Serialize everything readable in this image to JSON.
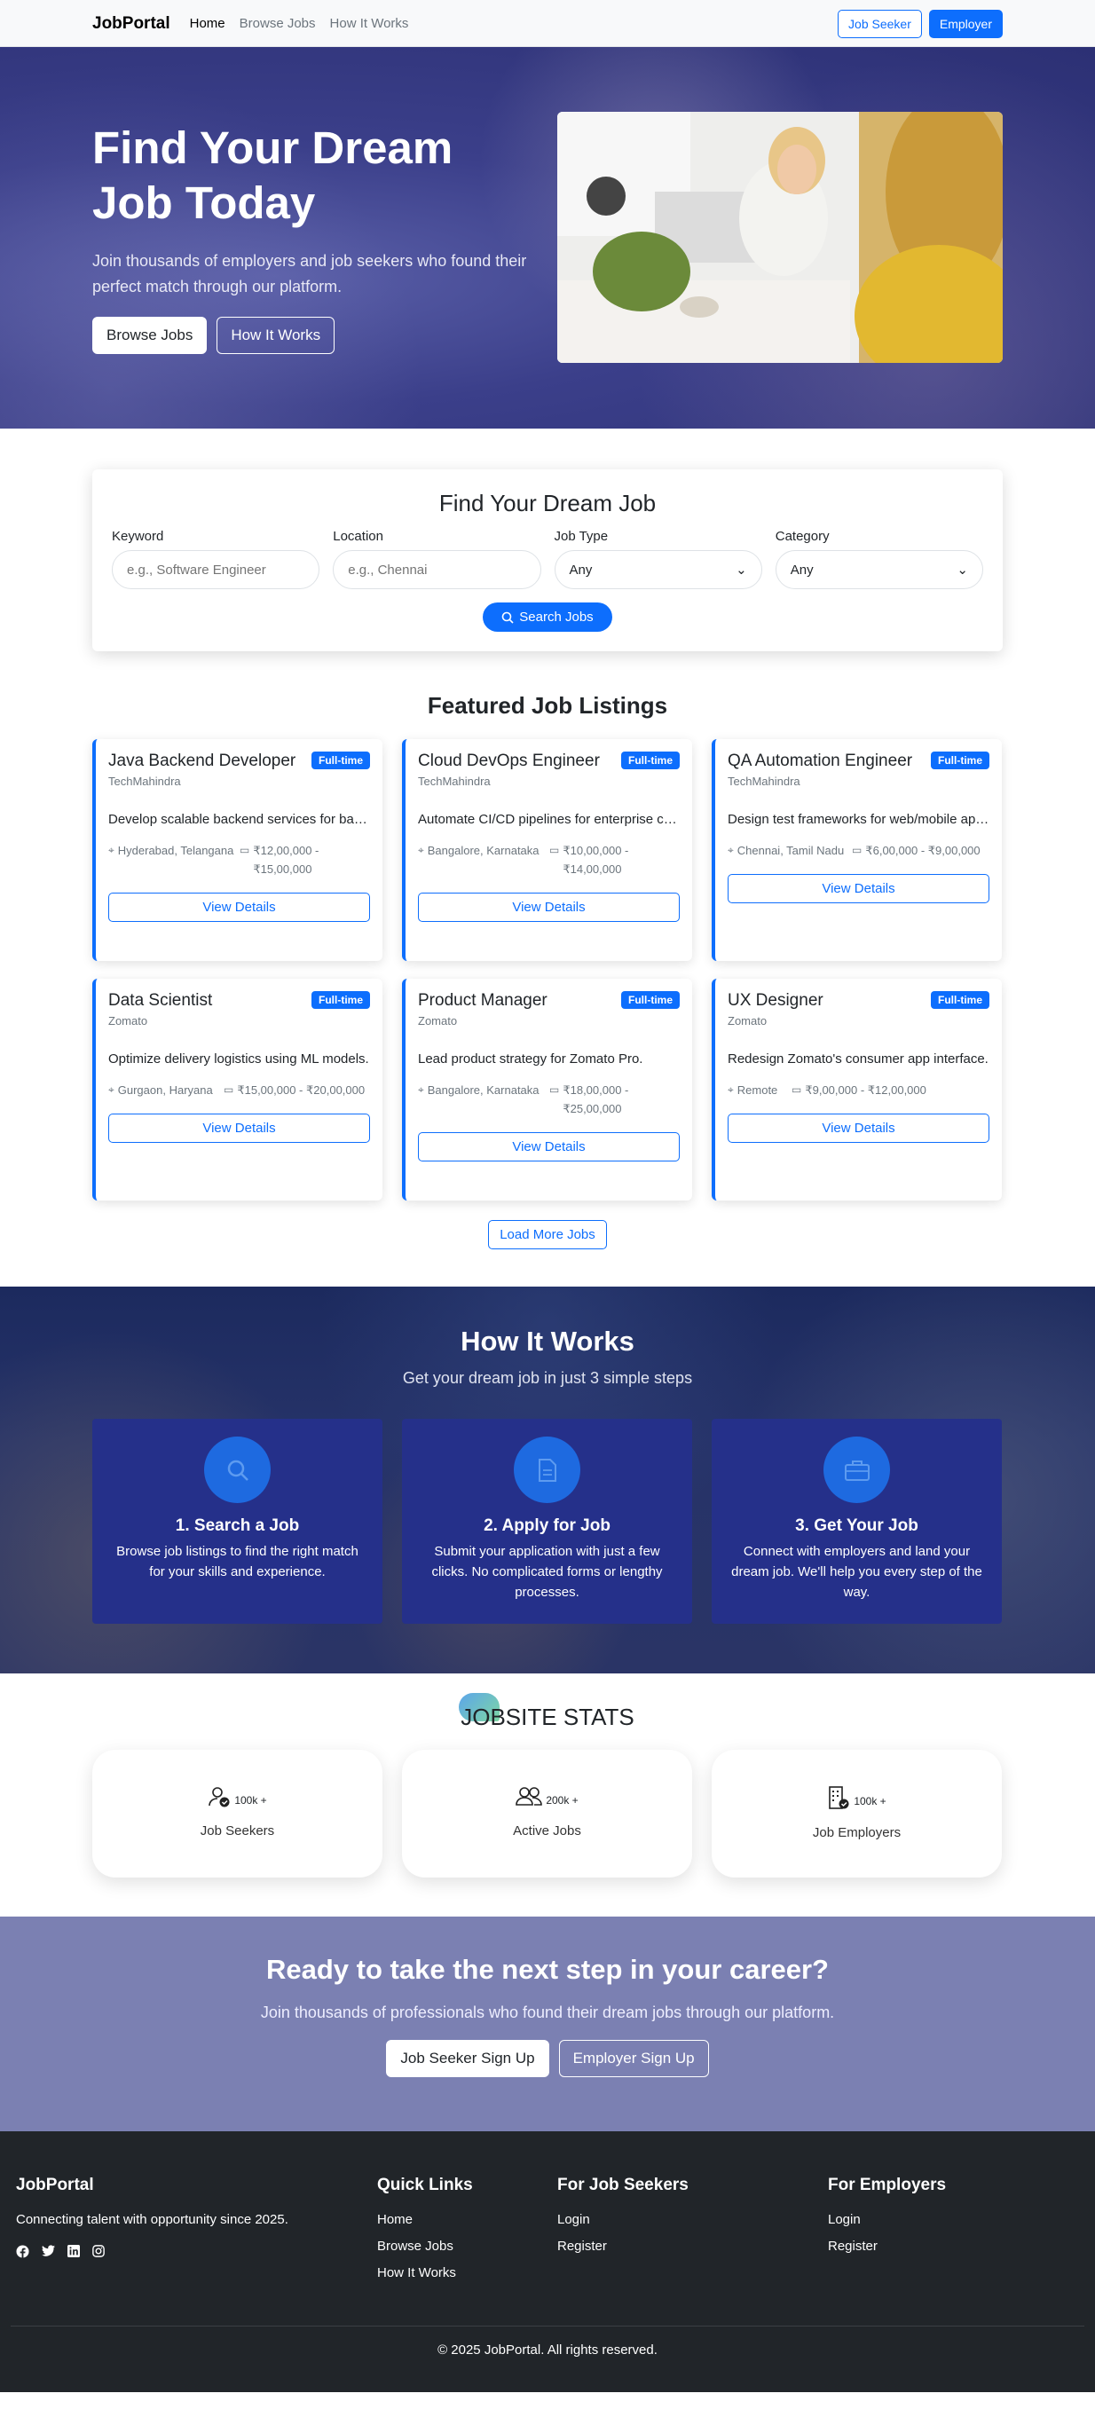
{
  "nav": {
    "brand": "JobPortal",
    "links": [
      "Home",
      "Browse Jobs",
      "How It Works"
    ],
    "job_seeker": "Job Seeker",
    "employer": "Employer"
  },
  "hero": {
    "title": "Find Your Dream Job Today",
    "subtitle": "Join thousands of employers and job seekers who found their perfect match through our platform.",
    "browse_btn": "Browse Jobs",
    "how_btn": "How It Works"
  },
  "search": {
    "title": "Find Your Dream Job",
    "keyword_label": "Keyword",
    "keyword_placeholder": "e.g., Software Engineer",
    "location_label": "Location",
    "location_placeholder": "e.g., Chennai",
    "type_label": "Job Type",
    "type_value": "Any",
    "category_label": "Category",
    "category_value": "Any",
    "button": "Search Jobs"
  },
  "featured": {
    "title": "Featured Job Listings",
    "view_details": "View Details",
    "load_more": "Load More Jobs",
    "jobs": [
      {
        "title": "Java Backend Developer",
        "badge": "Full-time",
        "company": "TechMahindra",
        "desc": "Develop scalable backend services for banking applications.",
        "location": "Hyderabad, Telangana",
        "salary": "₹12,00,000 - ₹15,00,000"
      },
      {
        "title": "Cloud DevOps Engineer",
        "badge": "Full-time",
        "company": "TechMahindra",
        "desc": "Automate CI/CD pipelines for enterprise clients.",
        "location": "Bangalore, Karnataka",
        "salary": "₹10,00,000 - ₹14,00,000"
      },
      {
        "title": "QA Automation Engineer",
        "badge": "Full-time",
        "company": "TechMahindra",
        "desc": "Design test frameworks for web/mobile applications.",
        "location": "Chennai, Tamil Nadu",
        "salary": "₹6,00,000 - ₹9,00,000"
      },
      {
        "title": "Data Scientist",
        "badge": "Full-time",
        "company": "Zomato",
        "desc": "Optimize delivery logistics using ML models.",
        "location": "Gurgaon, Haryana",
        "salary": "₹15,00,000 - ₹20,00,000"
      },
      {
        "title": "Product Manager",
        "badge": "Full-time",
        "company": "Zomato",
        "desc": "Lead product strategy for Zomato Pro.",
        "location": "Bangalore, Karnataka",
        "salary": "₹18,00,000 - ₹25,00,000"
      },
      {
        "title": "UX Designer",
        "badge": "Full-time",
        "company": "Zomato",
        "desc": "Redesign Zomato's consumer app interface.",
        "location": "Remote",
        "salary": "₹9,00,000 - ₹12,00,000"
      }
    ]
  },
  "how": {
    "title": "How It Works",
    "subtitle": "Get your dream job in just 3 simple steps",
    "steps": [
      {
        "title": "1. Search a Job",
        "desc": "Browse job listings to find the right match for your skills and experience.",
        "icon": "search-icon"
      },
      {
        "title": "2. Apply for Job",
        "desc": "Submit your application with just a few clicks. No complicated forms or lengthy processes.",
        "icon": "document-icon"
      },
      {
        "title": "3. Get Your Job",
        "desc": "Connect with employers and land your dream job. We'll help you every step of the way.",
        "icon": "briefcase-icon"
      }
    ]
  },
  "stats": {
    "title": "JOBSITE STATS",
    "items": [
      {
        "count": "100k +",
        "label": "Job Seekers",
        "icon": "user-check-icon"
      },
      {
        "count": "200k +",
        "label": "Active Jobs",
        "icon": "people-icon"
      },
      {
        "count": "100k +",
        "label": "Job Employers",
        "icon": "building-icon"
      }
    ]
  },
  "cta": {
    "title": "Ready to take the next step in your career?",
    "subtitle": "Join thousands of professionals who found their dream jobs through our platform.",
    "seeker_btn": "Job Seeker Sign Up",
    "employer_btn": "Employer Sign Up"
  },
  "footer": {
    "brand": "JobPortal",
    "tagline": "Connecting talent with opportunity since 2025.",
    "quick_title": "Quick Links",
    "quick_links": [
      "Home",
      "Browse Jobs",
      "How It Works"
    ],
    "seekers_title": "For Job Seekers",
    "seekers_links": [
      "Login",
      "Register"
    ],
    "employers_title": "For Employers",
    "employers_links": [
      "Login",
      "Register"
    ],
    "copyright": "© 2025 JobPortal. All rights reserved."
  },
  "colors": {
    "primary": "#0d6efd",
    "footer_bg": "#212529",
    "cta_bg": "#7b80b2",
    "step_bg": "#25308a"
  }
}
